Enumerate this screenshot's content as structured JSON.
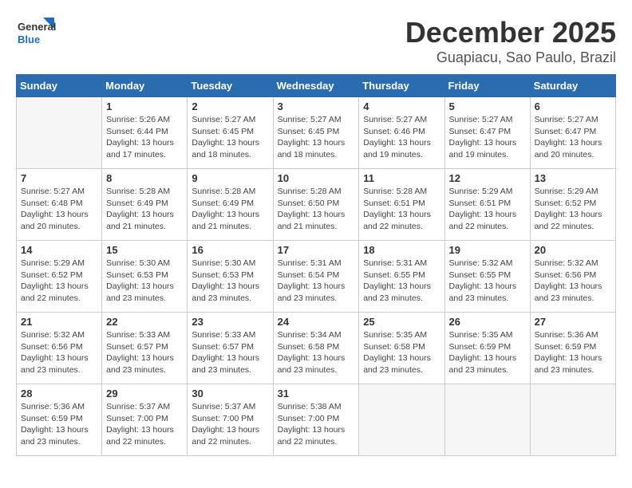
{
  "logo": {
    "general": "General",
    "blue": "Blue"
  },
  "header": {
    "month": "December 2025",
    "location": "Guapiacu, Sao Paulo, Brazil"
  },
  "days_of_week": [
    "Sunday",
    "Monday",
    "Tuesday",
    "Wednesday",
    "Thursday",
    "Friday",
    "Saturday"
  ],
  "weeks": [
    [
      {
        "day": "",
        "empty": true
      },
      {
        "day": "1",
        "sunrise": "Sunrise: 5:26 AM",
        "sunset": "Sunset: 6:44 PM",
        "daylight": "Daylight: 13 hours and 17 minutes."
      },
      {
        "day": "2",
        "sunrise": "Sunrise: 5:27 AM",
        "sunset": "Sunset: 6:45 PM",
        "daylight": "Daylight: 13 hours and 18 minutes."
      },
      {
        "day": "3",
        "sunrise": "Sunrise: 5:27 AM",
        "sunset": "Sunset: 6:45 PM",
        "daylight": "Daylight: 13 hours and 18 minutes."
      },
      {
        "day": "4",
        "sunrise": "Sunrise: 5:27 AM",
        "sunset": "Sunset: 6:46 PM",
        "daylight": "Daylight: 13 hours and 19 minutes."
      },
      {
        "day": "5",
        "sunrise": "Sunrise: 5:27 AM",
        "sunset": "Sunset: 6:47 PM",
        "daylight": "Daylight: 13 hours and 19 minutes."
      },
      {
        "day": "6",
        "sunrise": "Sunrise: 5:27 AM",
        "sunset": "Sunset: 6:47 PM",
        "daylight": "Daylight: 13 hours and 20 minutes."
      }
    ],
    [
      {
        "day": "7",
        "sunrise": "Sunrise: 5:27 AM",
        "sunset": "Sunset: 6:48 PM",
        "daylight": "Daylight: 13 hours and 20 minutes."
      },
      {
        "day": "8",
        "sunrise": "Sunrise: 5:28 AM",
        "sunset": "Sunset: 6:49 PM",
        "daylight": "Daylight: 13 hours and 21 minutes."
      },
      {
        "day": "9",
        "sunrise": "Sunrise: 5:28 AM",
        "sunset": "Sunset: 6:49 PM",
        "daylight": "Daylight: 13 hours and 21 minutes."
      },
      {
        "day": "10",
        "sunrise": "Sunrise: 5:28 AM",
        "sunset": "Sunset: 6:50 PM",
        "daylight": "Daylight: 13 hours and 21 minutes."
      },
      {
        "day": "11",
        "sunrise": "Sunrise: 5:28 AM",
        "sunset": "Sunset: 6:51 PM",
        "daylight": "Daylight: 13 hours and 22 minutes."
      },
      {
        "day": "12",
        "sunrise": "Sunrise: 5:29 AM",
        "sunset": "Sunset: 6:51 PM",
        "daylight": "Daylight: 13 hours and 22 minutes."
      },
      {
        "day": "13",
        "sunrise": "Sunrise: 5:29 AM",
        "sunset": "Sunset: 6:52 PM",
        "daylight": "Daylight: 13 hours and 22 minutes."
      }
    ],
    [
      {
        "day": "14",
        "sunrise": "Sunrise: 5:29 AM",
        "sunset": "Sunset: 6:52 PM",
        "daylight": "Daylight: 13 hours and 22 minutes."
      },
      {
        "day": "15",
        "sunrise": "Sunrise: 5:30 AM",
        "sunset": "Sunset: 6:53 PM",
        "daylight": "Daylight: 13 hours and 23 minutes."
      },
      {
        "day": "16",
        "sunrise": "Sunrise: 5:30 AM",
        "sunset": "Sunset: 6:53 PM",
        "daylight": "Daylight: 13 hours and 23 minutes."
      },
      {
        "day": "17",
        "sunrise": "Sunrise: 5:31 AM",
        "sunset": "Sunset: 6:54 PM",
        "daylight": "Daylight: 13 hours and 23 minutes."
      },
      {
        "day": "18",
        "sunrise": "Sunrise: 5:31 AM",
        "sunset": "Sunset: 6:55 PM",
        "daylight": "Daylight: 13 hours and 23 minutes."
      },
      {
        "day": "19",
        "sunrise": "Sunrise: 5:32 AM",
        "sunset": "Sunset: 6:55 PM",
        "daylight": "Daylight: 13 hours and 23 minutes."
      },
      {
        "day": "20",
        "sunrise": "Sunrise: 5:32 AM",
        "sunset": "Sunset: 6:56 PM",
        "daylight": "Daylight: 13 hours and 23 minutes."
      }
    ],
    [
      {
        "day": "21",
        "sunrise": "Sunrise: 5:32 AM",
        "sunset": "Sunset: 6:56 PM",
        "daylight": "Daylight: 13 hours and 23 minutes."
      },
      {
        "day": "22",
        "sunrise": "Sunrise: 5:33 AM",
        "sunset": "Sunset: 6:57 PM",
        "daylight": "Daylight: 13 hours and 23 minutes."
      },
      {
        "day": "23",
        "sunrise": "Sunrise: 5:33 AM",
        "sunset": "Sunset: 6:57 PM",
        "daylight": "Daylight: 13 hours and 23 minutes."
      },
      {
        "day": "24",
        "sunrise": "Sunrise: 5:34 AM",
        "sunset": "Sunset: 6:58 PM",
        "daylight": "Daylight: 13 hours and 23 minutes."
      },
      {
        "day": "25",
        "sunrise": "Sunrise: 5:35 AM",
        "sunset": "Sunset: 6:58 PM",
        "daylight": "Daylight: 13 hours and 23 minutes."
      },
      {
        "day": "26",
        "sunrise": "Sunrise: 5:35 AM",
        "sunset": "Sunset: 6:59 PM",
        "daylight": "Daylight: 13 hours and 23 minutes."
      },
      {
        "day": "27",
        "sunrise": "Sunrise: 5:36 AM",
        "sunset": "Sunset: 6:59 PM",
        "daylight": "Daylight: 13 hours and 23 minutes."
      }
    ],
    [
      {
        "day": "28",
        "sunrise": "Sunrise: 5:36 AM",
        "sunset": "Sunset: 6:59 PM",
        "daylight": "Daylight: 13 hours and 23 minutes."
      },
      {
        "day": "29",
        "sunrise": "Sunrise: 5:37 AM",
        "sunset": "Sunset: 7:00 PM",
        "daylight": "Daylight: 13 hours and 22 minutes."
      },
      {
        "day": "30",
        "sunrise": "Sunrise: 5:37 AM",
        "sunset": "Sunset: 7:00 PM",
        "daylight": "Daylight: 13 hours and 22 minutes."
      },
      {
        "day": "31",
        "sunrise": "Sunrise: 5:38 AM",
        "sunset": "Sunset: 7:00 PM",
        "daylight": "Daylight: 13 hours and 22 minutes."
      },
      {
        "day": "",
        "empty": true
      },
      {
        "day": "",
        "empty": true
      },
      {
        "day": "",
        "empty": true
      }
    ]
  ]
}
